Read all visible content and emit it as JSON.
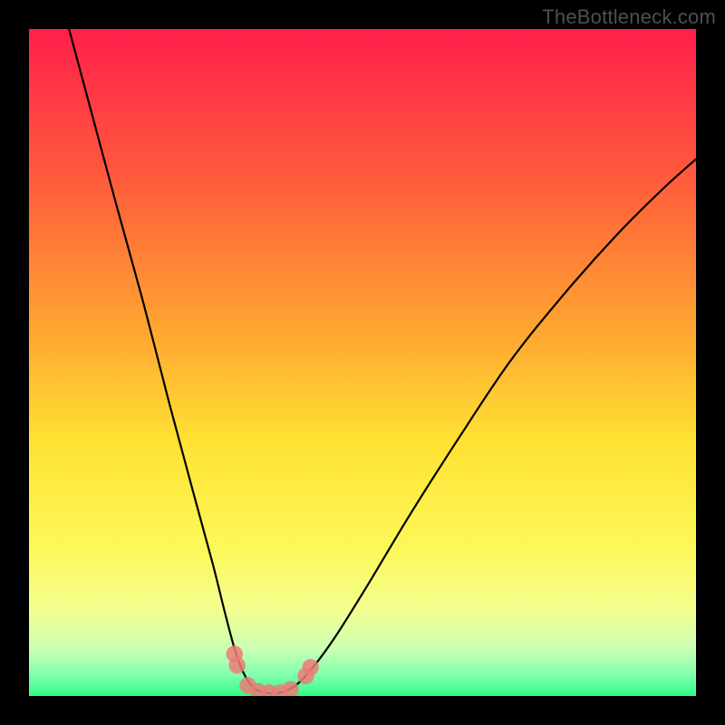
{
  "watermark": "TheBottleneck.com",
  "chart_data": {
    "type": "line",
    "title": "",
    "xlabel": "",
    "ylabel": "",
    "xlim": [
      0,
      100
    ],
    "ylim": [
      0,
      100
    ],
    "gradient_stops": [
      {
        "offset": 0,
        "color": "#ff1f4b"
      },
      {
        "offset": 22,
        "color": "#ff5a3c"
      },
      {
        "offset": 45,
        "color": "#ffa531"
      },
      {
        "offset": 62,
        "color": "#ffe233"
      },
      {
        "offset": 78,
        "color": "#fdf85a"
      },
      {
        "offset": 87,
        "color": "#f3ff8f"
      },
      {
        "offset": 93,
        "color": "#caffb4"
      },
      {
        "offset": 97,
        "color": "#7dffad"
      },
      {
        "offset": 100,
        "color": "#2dfd86"
      }
    ],
    "series": [
      {
        "name": "bottleneck-curve",
        "points": [
          {
            "x": 6.0,
            "y": 100.0
          },
          {
            "x": 9.5,
            "y": 87.0
          },
          {
            "x": 13.0,
            "y": 74.0
          },
          {
            "x": 17.0,
            "y": 59.5
          },
          {
            "x": 21.0,
            "y": 44.0
          },
          {
            "x": 24.5,
            "y": 31.0
          },
          {
            "x": 27.5,
            "y": 20.0
          },
          {
            "x": 29.5,
            "y": 12.0
          },
          {
            "x": 31.0,
            "y": 6.5
          },
          {
            "x": 32.5,
            "y": 2.8
          },
          {
            "x": 34.0,
            "y": 1.0
          },
          {
            "x": 36.0,
            "y": 0.4
          },
          {
            "x": 38.0,
            "y": 0.6
          },
          {
            "x": 40.0,
            "y": 1.6
          },
          {
            "x": 42.5,
            "y": 4.2
          },
          {
            "x": 46.0,
            "y": 9.0
          },
          {
            "x": 51.0,
            "y": 17.0
          },
          {
            "x": 57.0,
            "y": 27.0
          },
          {
            "x": 64.0,
            "y": 38.0
          },
          {
            "x": 72.0,
            "y": 50.0
          },
          {
            "x": 80.0,
            "y": 60.0
          },
          {
            "x": 88.0,
            "y": 69.0
          },
          {
            "x": 95.0,
            "y": 76.0
          },
          {
            "x": 100.0,
            "y": 80.5
          }
        ]
      }
    ],
    "markers": [
      {
        "x": 30.8,
        "y": 6.3
      },
      {
        "x": 31.2,
        "y": 4.6
      },
      {
        "x": 32.8,
        "y": 1.6
      },
      {
        "x": 34.4,
        "y": 0.7
      },
      {
        "x": 36.0,
        "y": 0.5
      },
      {
        "x": 37.6,
        "y": 0.5
      },
      {
        "x": 39.2,
        "y": 1.0
      },
      {
        "x": 41.5,
        "y": 3.0
      },
      {
        "x": 42.2,
        "y": 4.3
      }
    ],
    "marker_radius_pct": 1.25
  }
}
